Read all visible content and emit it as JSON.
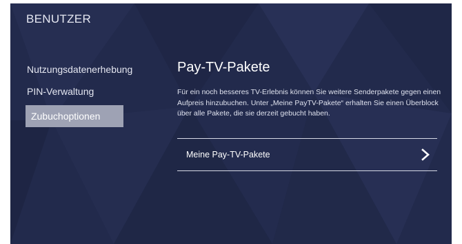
{
  "header": {
    "title": "BENUTZER"
  },
  "sidebar": {
    "items": [
      {
        "label": "Nutzungsdatenerhebung",
        "active": false
      },
      {
        "label": "PIN-Verwaltung",
        "active": false
      },
      {
        "label": "Zubuchoptionen",
        "active": true
      }
    ]
  },
  "panel": {
    "heading": "Pay-TV-Pakete",
    "description": "Für ein noch besseres TV-Erlebnis können Sie weitere Senderpakete gegen einen Aufpreis hinzubuchen. Unter „Meine PayTV-Pakete“ erhalten Sie einen Überblock über alle Pakete, die sie derzeit gebucht haben.",
    "package_link": {
      "label": "Meine Pay-TV-Pakete",
      "icon": "chevron-right-icon"
    }
  },
  "colors": {
    "background": "#222a4c",
    "active_item": "#9ea2b4",
    "text": "#ffffff"
  }
}
